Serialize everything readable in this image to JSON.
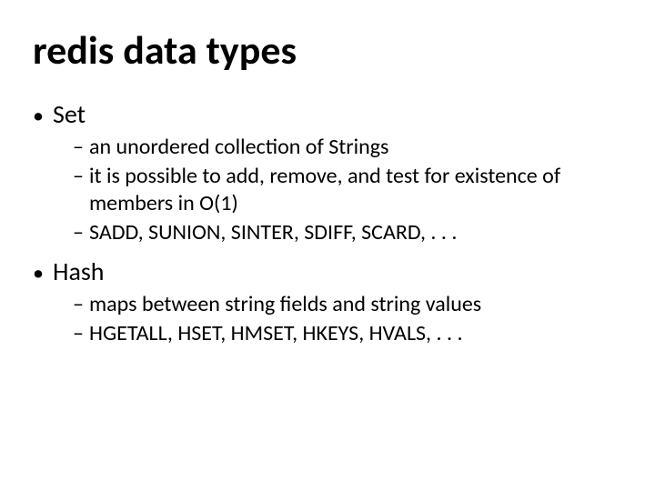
{
  "title": "redis data types",
  "bullets": {
    "l1": [
      {
        "label": "Set"
      },
      {
        "label": "Hash"
      }
    ],
    "set_sub": [
      "an unordered collection of Strings",
      "it is possible to add, remove, and test for existence of members in O(1)",
      "SADD, SUNION, SINTER, SDIFF, SCARD, . . ."
    ],
    "hash_sub": [
      "maps between string fields and string values",
      "HGETALL, HSET, HMSET, HKEYS, HVALS, . . ."
    ]
  },
  "glyphs": {
    "dot": "•",
    "dash": "–"
  }
}
